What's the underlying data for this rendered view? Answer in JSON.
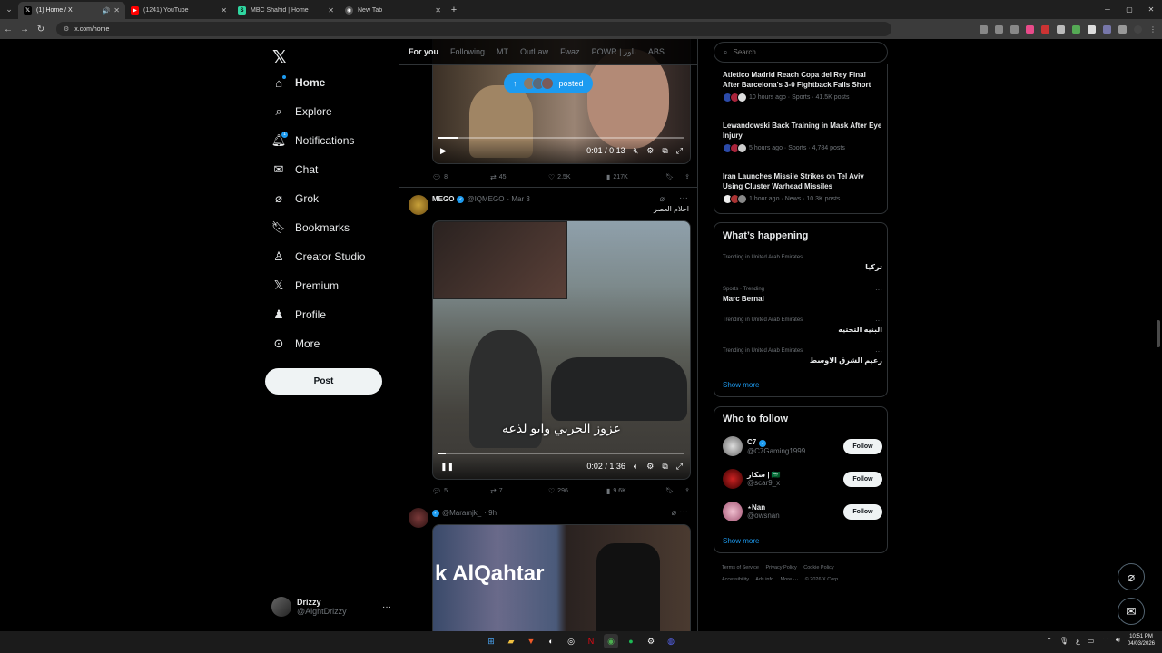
{
  "browser": {
    "tabs": [
      {
        "title": "(1) Home / X",
        "active": true
      },
      {
        "title": "(1241) YouTube",
        "active": false
      },
      {
        "title": "MBC Shahid | Home",
        "active": false
      },
      {
        "title": "New Tab",
        "active": false
      }
    ],
    "url": "x.com/home"
  },
  "leftnav": {
    "items": [
      {
        "label": "Home",
        "icon": "home-icon"
      },
      {
        "label": "Explore",
        "icon": "search-icon"
      },
      {
        "label": "Notifications",
        "icon": "bell-icon"
      },
      {
        "label": "Chat",
        "icon": "mail-icon"
      },
      {
        "label": "Grok",
        "icon": "grok-icon"
      },
      {
        "label": "Bookmarks",
        "icon": "bookmark-icon"
      },
      {
        "label": "Creator Studio",
        "icon": "creator-icon"
      },
      {
        "label": "Premium",
        "icon": "x-icon"
      },
      {
        "label": "Profile",
        "icon": "person-icon"
      },
      {
        "label": "More",
        "icon": "more-circle-icon"
      }
    ],
    "notification_badge": "1",
    "post_label": "Post",
    "user": {
      "name": "Drizzy",
      "handle": "@AightDrizzy"
    }
  },
  "feed": {
    "tabs": [
      "For you",
      "Following",
      "MT",
      "OutLaw",
      "Fwaz",
      "POWR | باور",
      "ABS"
    ],
    "posted_pill": "posted",
    "post1": {
      "time": "0:01 / 0:13",
      "progress": 0.08,
      "replies": "8",
      "reposts": "45",
      "likes": "2.5K",
      "views": "217K"
    },
    "post2": {
      "name": "MEGO",
      "handle": "@IQMEGO",
      "date": "· Mar 3",
      "text": "احلام العصر",
      "caption": "عزوز الحربي وابو لذعه",
      "time": "0:02 / 1:36",
      "progress": 0.03,
      "replies": "5",
      "reposts": "7",
      "likes": "296",
      "views": "9.6K"
    },
    "post3": {
      "handle": "@Maramjk_",
      "date": "· 9h",
      "image_text": "k AlQahtar"
    }
  },
  "right": {
    "search_placeholder": "Search",
    "news": [
      {
        "title": "Atletico Madrid Reach Copa del Rey Final After Barcelona's 3-0 Fightback Falls Short",
        "meta": "10 hours ago · Sports · 41.5K posts"
      },
      {
        "title": "Lewandowski Back Training in Mask After Eye Injury",
        "meta": "5 hours ago · Sports · 4,784 posts"
      },
      {
        "title": "Iran Launches Missile Strikes on Tel Aviv Using Cluster Warhead Missiles",
        "meta": "1 hour ago · News · 10.3K posts"
      }
    ],
    "whats_happening": {
      "title": "What’s happening",
      "trends": [
        {
          "context": "Trending in United Arab Emirates",
          "name": "تركيا"
        },
        {
          "context": "Sports · Trending",
          "name": "Marc Bernal"
        },
        {
          "context": "Trending in United Arab Emirates",
          "name": "البنيه التحتيه"
        },
        {
          "context": "Trending in United Arab Emirates",
          "name": "زعيم الشرق الاوسط"
        }
      ],
      "show_more": "Show more"
    },
    "who_to_follow": {
      "title": "Who to follow",
      "people": [
        {
          "name": "C7",
          "handle": "@C7Gaming1999",
          "verified": true
        },
        {
          "name": "سكار | 🇸🇦",
          "handle": "@scar9_x",
          "verified": false
        },
        {
          "name": "⋆Nan",
          "handle": "@owsnan",
          "verified": false
        }
      ],
      "follow_label": "Follow",
      "show_more": "Show more"
    },
    "footer": [
      "Terms of Service",
      "Privacy Policy",
      "Cookie Policy",
      "Accessibility",
      "Ads info",
      "More ···",
      "© 2026 X Corp."
    ]
  },
  "taskbar": {
    "time": "10:51 PM",
    "date": "04/03/2026",
    "lang": "ع"
  },
  "colors": {
    "accent": "#1d9bf0",
    "background": "#000000",
    "border": "#2f3336"
  }
}
